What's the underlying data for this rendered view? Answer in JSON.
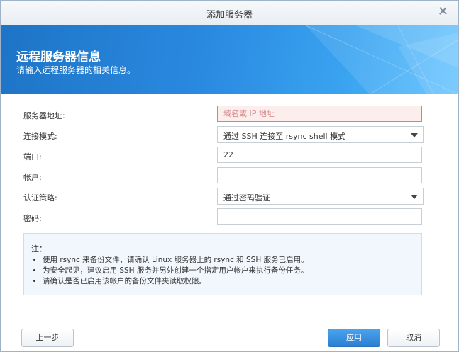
{
  "dialog": {
    "title": "添加服务器",
    "close_glyph": "✕"
  },
  "banner": {
    "heading": "远程服务器信息",
    "subheading": "请输入远程服务器的相关信息。"
  },
  "form": {
    "server_address": {
      "label": "服务器地址:",
      "value": "",
      "placeholder": "域名或 IP 地址",
      "state": "error"
    },
    "connection_mode": {
      "label": "连接模式:",
      "value": "通过 SSH 连接至 rsync shell 模式"
    },
    "port": {
      "label": "端口:",
      "value": "22"
    },
    "account": {
      "label": "帐户:",
      "value": ""
    },
    "auth_policy": {
      "label": "认证策略:",
      "value": "通过密码验证"
    },
    "password": {
      "label": "密码:",
      "value": ""
    }
  },
  "note": {
    "title": "注：",
    "items": [
      "使用 rsync 来备份文件，请确认 Linux 服务器上的 rsync 和 SSH 服务已启用。",
      "为安全起见，建议启用 SSH 服务并另外创建一个指定用户帐户来执行备份任务。",
      "请确认是否已启用该帐户的备份文件夹读取权限。"
    ]
  },
  "buttons": {
    "back": "上一步",
    "apply": "应用",
    "cancel": "取消"
  },
  "colors": {
    "banner_blue": "#2a8ae0",
    "primary_button": "#2b7fd2",
    "error_border": "#e37b7b"
  }
}
